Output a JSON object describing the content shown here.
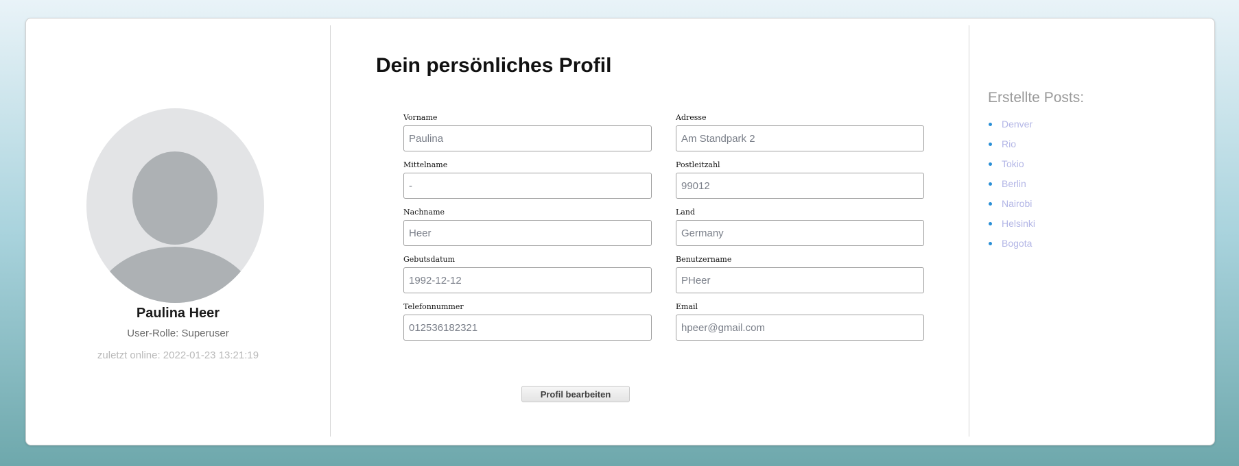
{
  "profile": {
    "name": "Paulina Heer",
    "role": "User-Rolle: Superuser",
    "last_online": "zuletzt online: 2022-01-23 13:21:19"
  },
  "form": {
    "title": "Dein persönliches Profil",
    "fields": {
      "vorname": {
        "label": "Vorname",
        "value": "Paulina"
      },
      "mittelname": {
        "label": "Mittelname",
        "value": "-"
      },
      "nachname": {
        "label": "Nachname",
        "value": "Heer"
      },
      "geburtsdatum": {
        "label": "Gebutsdatum",
        "value": "1992-12-12"
      },
      "telefon": {
        "label": "Telefonnummer",
        "value": "012536182321"
      },
      "adresse": {
        "label": "Adresse",
        "value": "Am Standpark 2"
      },
      "plz": {
        "label": "Postleitzahl",
        "value": "99012"
      },
      "land": {
        "label": "Land",
        "value": "Germany"
      },
      "benutzername": {
        "label": "Benutzername",
        "value": "PHeer"
      },
      "email": {
        "label": "Email",
        "value": "hpeer@gmail.com"
      }
    },
    "edit_button": "Profil bearbeiten"
  },
  "posts": {
    "title": "Erstellte Posts:",
    "items": [
      "Denver",
      "Rio",
      "Tokio",
      "Berlin",
      "Nairobi",
      "Helsinki",
      "Bogota"
    ]
  },
  "colors": {
    "background_top": "#e9f3f8",
    "background_bottom": "#6ea8ac",
    "link": "#b3b6e6",
    "bullet": "#2a8fd6"
  }
}
